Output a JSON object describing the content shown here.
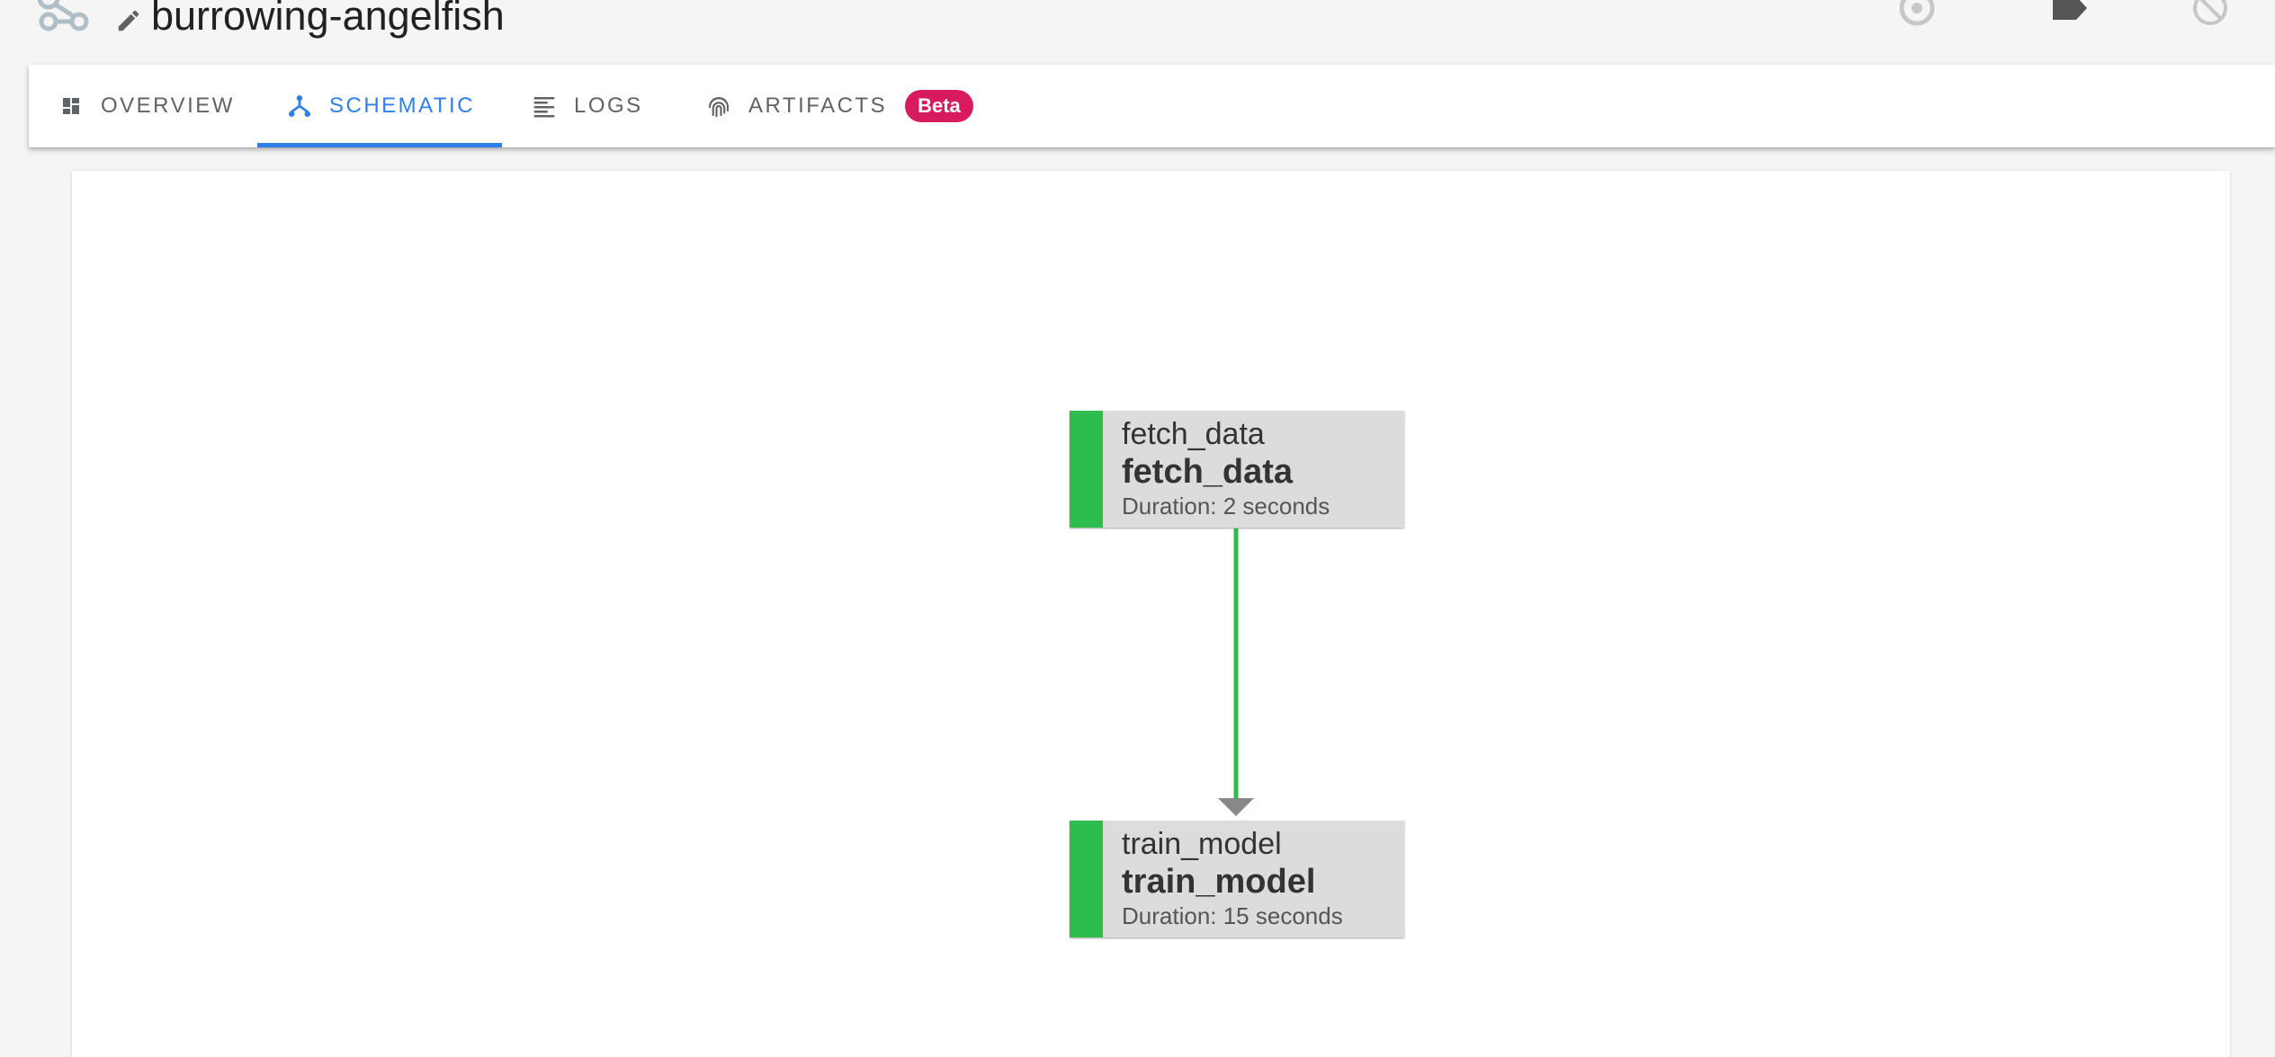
{
  "header": {
    "title": "burrowing-angelfish"
  },
  "tabs": [
    {
      "label": "OVERVIEW",
      "icon": "dashboard-icon",
      "active": false
    },
    {
      "label": "SCHEMATIC",
      "icon": "schematic-icon",
      "active": true
    },
    {
      "label": "LOGS",
      "icon": "logs-icon",
      "active": false
    },
    {
      "label": "ARTIFACTS",
      "icon": "fingerprint-icon",
      "active": false,
      "badge": "Beta"
    }
  ],
  "schematic": {
    "nodes": [
      {
        "id": "fetch_data",
        "name": "fetch_data",
        "label": "fetch_data",
        "duration": "Duration: 2 seconds",
        "status_color": "#2dbd4e"
      },
      {
        "id": "train_model",
        "name": "train_model",
        "label": "train_model",
        "duration": "Duration: 15 seconds",
        "status_color": "#2dbd4e"
      }
    ],
    "edges": [
      {
        "from": "fetch_data",
        "to": "train_model",
        "color": "#2dbd4e"
      }
    ]
  },
  "colors": {
    "accent": "#2f80ed",
    "success": "#2dbd4e",
    "badge": "#d81b60"
  }
}
